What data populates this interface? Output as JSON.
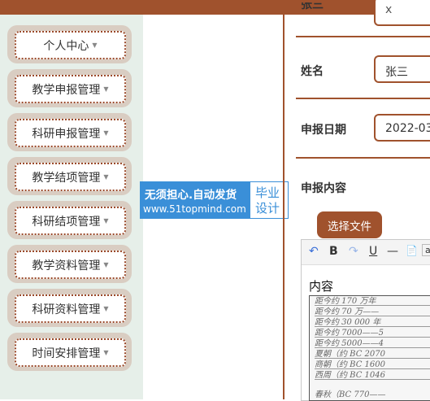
{
  "sidebar": {
    "items": [
      {
        "label": "个人中心"
      },
      {
        "label": "教学申报管理"
      },
      {
        "label": "科研申报管理"
      },
      {
        "label": "教学结项管理"
      },
      {
        "label": "科研结项管理"
      },
      {
        "label": "教学资料管理"
      },
      {
        "label": "科研资料管理"
      },
      {
        "label": "时间安排管理"
      }
    ],
    "caret": "▼"
  },
  "watermark": {
    "line1": "无须担心.自动发货",
    "line2": "www.51topmind.com",
    "right1": "毕业",
    "right2": "设计"
  },
  "form": {
    "top_label_partial": "张三",
    "top_value_partial": "x",
    "name_label": "姓名",
    "name_value": "张三",
    "date_label": "申报日期",
    "date_value": "2022-03",
    "content_label": "申报内容",
    "upload_button": "选择文件",
    "editor": {
      "toolbar": [
        "↶",
        "B",
        "↷",
        "U",
        "—",
        "📄",
        "a"
      ],
      "text": "内容"
    },
    "document_lines": [
      "距今约 170 万年",
      "距今约 70 万——",
      "距今约 30 000 年",
      "距今约 7000——5",
      "距今约 5000——4",
      "夏朝（约 BC 2070",
      "商朝（约 BC 1600",
      "西周（约 BC 1046",
      "",
      "春秋（BC 770——"
    ]
  },
  "colors": {
    "accent": "#a0522d",
    "sidebar_bg": "#e6efe9",
    "menu_bg": "#d9cdc2",
    "banner_blue": "#3a8fd8"
  }
}
